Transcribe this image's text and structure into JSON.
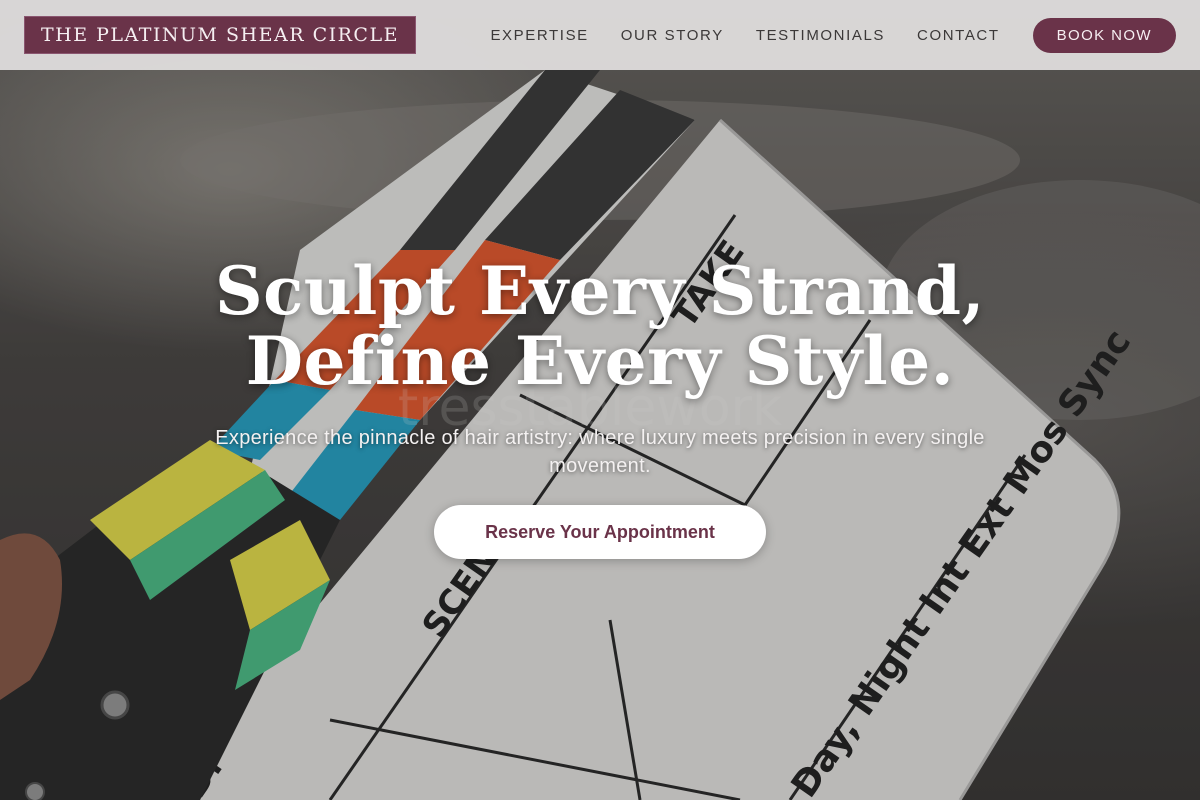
{
  "brand": {
    "name": "THE PLATINUM SHEAR CIRCLE"
  },
  "nav": {
    "items": [
      {
        "label": "EXPERTISE"
      },
      {
        "label": "OUR STORY"
      },
      {
        "label": "TESTIMONIALS"
      },
      {
        "label": "CONTACT"
      }
    ],
    "book_label": "BOOK NOW"
  },
  "hero": {
    "headline_line1": "Sculpt Every Strand,",
    "headline_line2": "Define Every Style.",
    "subheadline": "Experience the pinnacle of hair artistry: where luxury meets precision in every single movement.",
    "cta_label": "Reserve Your Appointment",
    "image": {
      "description_icon": "clapperboard-photo",
      "slate_text": {
        "scene": "SCENE",
        "take": "TAKE",
        "corner": "D.",
        "footer": "Day, Night  Int  Ext  Mos  Sync",
        "watermark": "tresstablework"
      }
    }
  },
  "colors": {
    "accent": "#6a3349",
    "header_bg": "#e2e0e0",
    "hero_text": "#ffffff",
    "nav_text": "#3b3838"
  }
}
